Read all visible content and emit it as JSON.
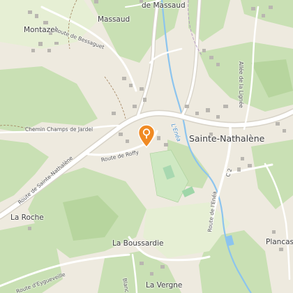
{
  "places": {
    "de_massaud": "de Massaud",
    "massaud": "Massaud",
    "montazel": "Montazel",
    "sainte_nathalene": "Sainte-Nathalène",
    "la_roche": "La Roche",
    "la_boussardie": "La Boussardie",
    "la_vergne": "La Vergne",
    "plancass": "Plancass"
  },
  "roads": {
    "route_de_bessaguet": "Route de Bessaguet",
    "chemin_champs_de_jardel": "Chemin Champs de Jardel",
    "route_de_sainte_nathalene": "Route de Sainte-Nathalène",
    "route_de_roffy": "Route de Roffy",
    "allee_de_la_lignee": "Allée de la Lignée",
    "route_de_l_enea": "Route de l'Enéa",
    "c2": "C 2",
    "route_d_eygueveille": "Route d'Eygueveille",
    "blanc": "Blanc"
  },
  "water": {
    "river": "L'Enéa"
  },
  "marker": {
    "icon": "map-pin-icon",
    "color": "#f08a24"
  },
  "colors": {
    "land": "#eeeadf",
    "forest": "#c9e0b4",
    "forest_dark": "#b7d59e",
    "field": "#e6efd4",
    "road": "#ffffff",
    "road_casing": "#d8d3c8",
    "water": "#8cc4ee",
    "building": "#b9b6b0",
    "pitch": "#9fd6a8"
  }
}
